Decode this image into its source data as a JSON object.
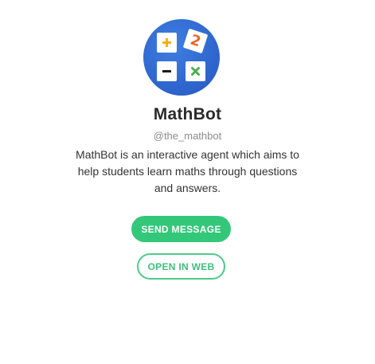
{
  "bot": {
    "name": "MathBot",
    "handle": "@the_mathbot",
    "description": "MathBot is an interactive agent which aims to help students learn maths through questions and answers."
  },
  "actions": {
    "send_label": "SEND MESSAGE",
    "open_web_label": "OPEN IN WEB"
  },
  "avatar": {
    "icons": [
      "plus-icon",
      "two-icon",
      "minus-icon",
      "times-icon"
    ],
    "tile_text_two": "2"
  },
  "colors": {
    "avatar_bg": "#2f67cf",
    "accent_green": "#33c77a",
    "plus_yellow": "#f2b21b",
    "two_orange": "#e8692a",
    "times_green": "#4caf50",
    "minus_black": "#1a1a1a"
  }
}
